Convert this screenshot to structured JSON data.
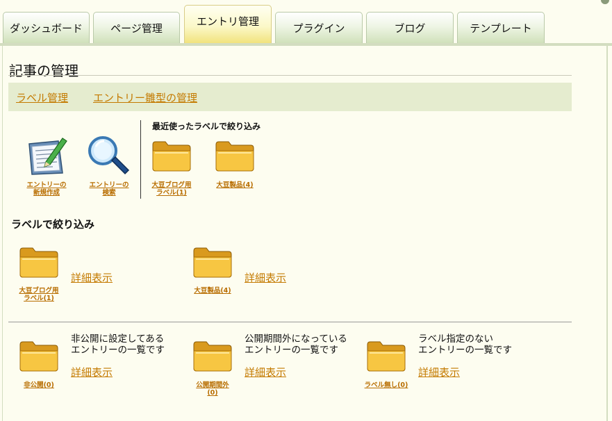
{
  "tabs": [
    {
      "label": "ダッシュボード"
    },
    {
      "label": "ページ管理"
    },
    {
      "label": "エントリ管理",
      "active": true
    },
    {
      "label": "プラグイン"
    },
    {
      "label": "ブログ"
    },
    {
      "label": "テンプレート"
    }
  ],
  "page": {
    "title": "記事の管理"
  },
  "subnav": {
    "label_manage": "ラベル管理",
    "template_manage": "エントリー雛型の管理"
  },
  "quick": {
    "new_entry": {
      "line1": "エントリーの",
      "line2": "新規作成"
    },
    "search_entry": {
      "line1": "エントリーの",
      "line2": "検索"
    },
    "recent_heading": "最近使ったラベルで絞り込み",
    "recent_labels": [
      {
        "line1": "大豆ブログ用",
        "line2": "ラベル(1)"
      },
      {
        "line1": "大豆製品(4)",
        "line2": ""
      }
    ]
  },
  "label_filter": {
    "heading": "ラベルで絞り込み",
    "items": [
      {
        "line1": "大豆ブログ用",
        "line2": "ラベル(1)",
        "detail": "詳細表示"
      },
      {
        "line1": "大豆製品(4)",
        "line2": "",
        "detail": "詳細表示"
      }
    ]
  },
  "special": [
    {
      "desc1": "非公開に設定してある",
      "desc2": "エントリーの一覧です",
      "detail": "詳細表示",
      "line1": "非公開(0)",
      "line2": ""
    },
    {
      "desc1": "公開期間外になっている",
      "desc2": "エントリーの一覧です",
      "detail": "詳細表示",
      "line1": "公開期間外",
      "line2": "(0)"
    },
    {
      "desc1": "ラベル指定のない",
      "desc2": "エントリーの一覧です",
      "detail": "詳細表示",
      "line1": "ラベル無し(0)",
      "line2": ""
    }
  ],
  "colors": {
    "link": "#c47a00",
    "tab_active": "#f1e27a",
    "tab": "#cfe0b9",
    "subbar": "#e5eccf"
  }
}
